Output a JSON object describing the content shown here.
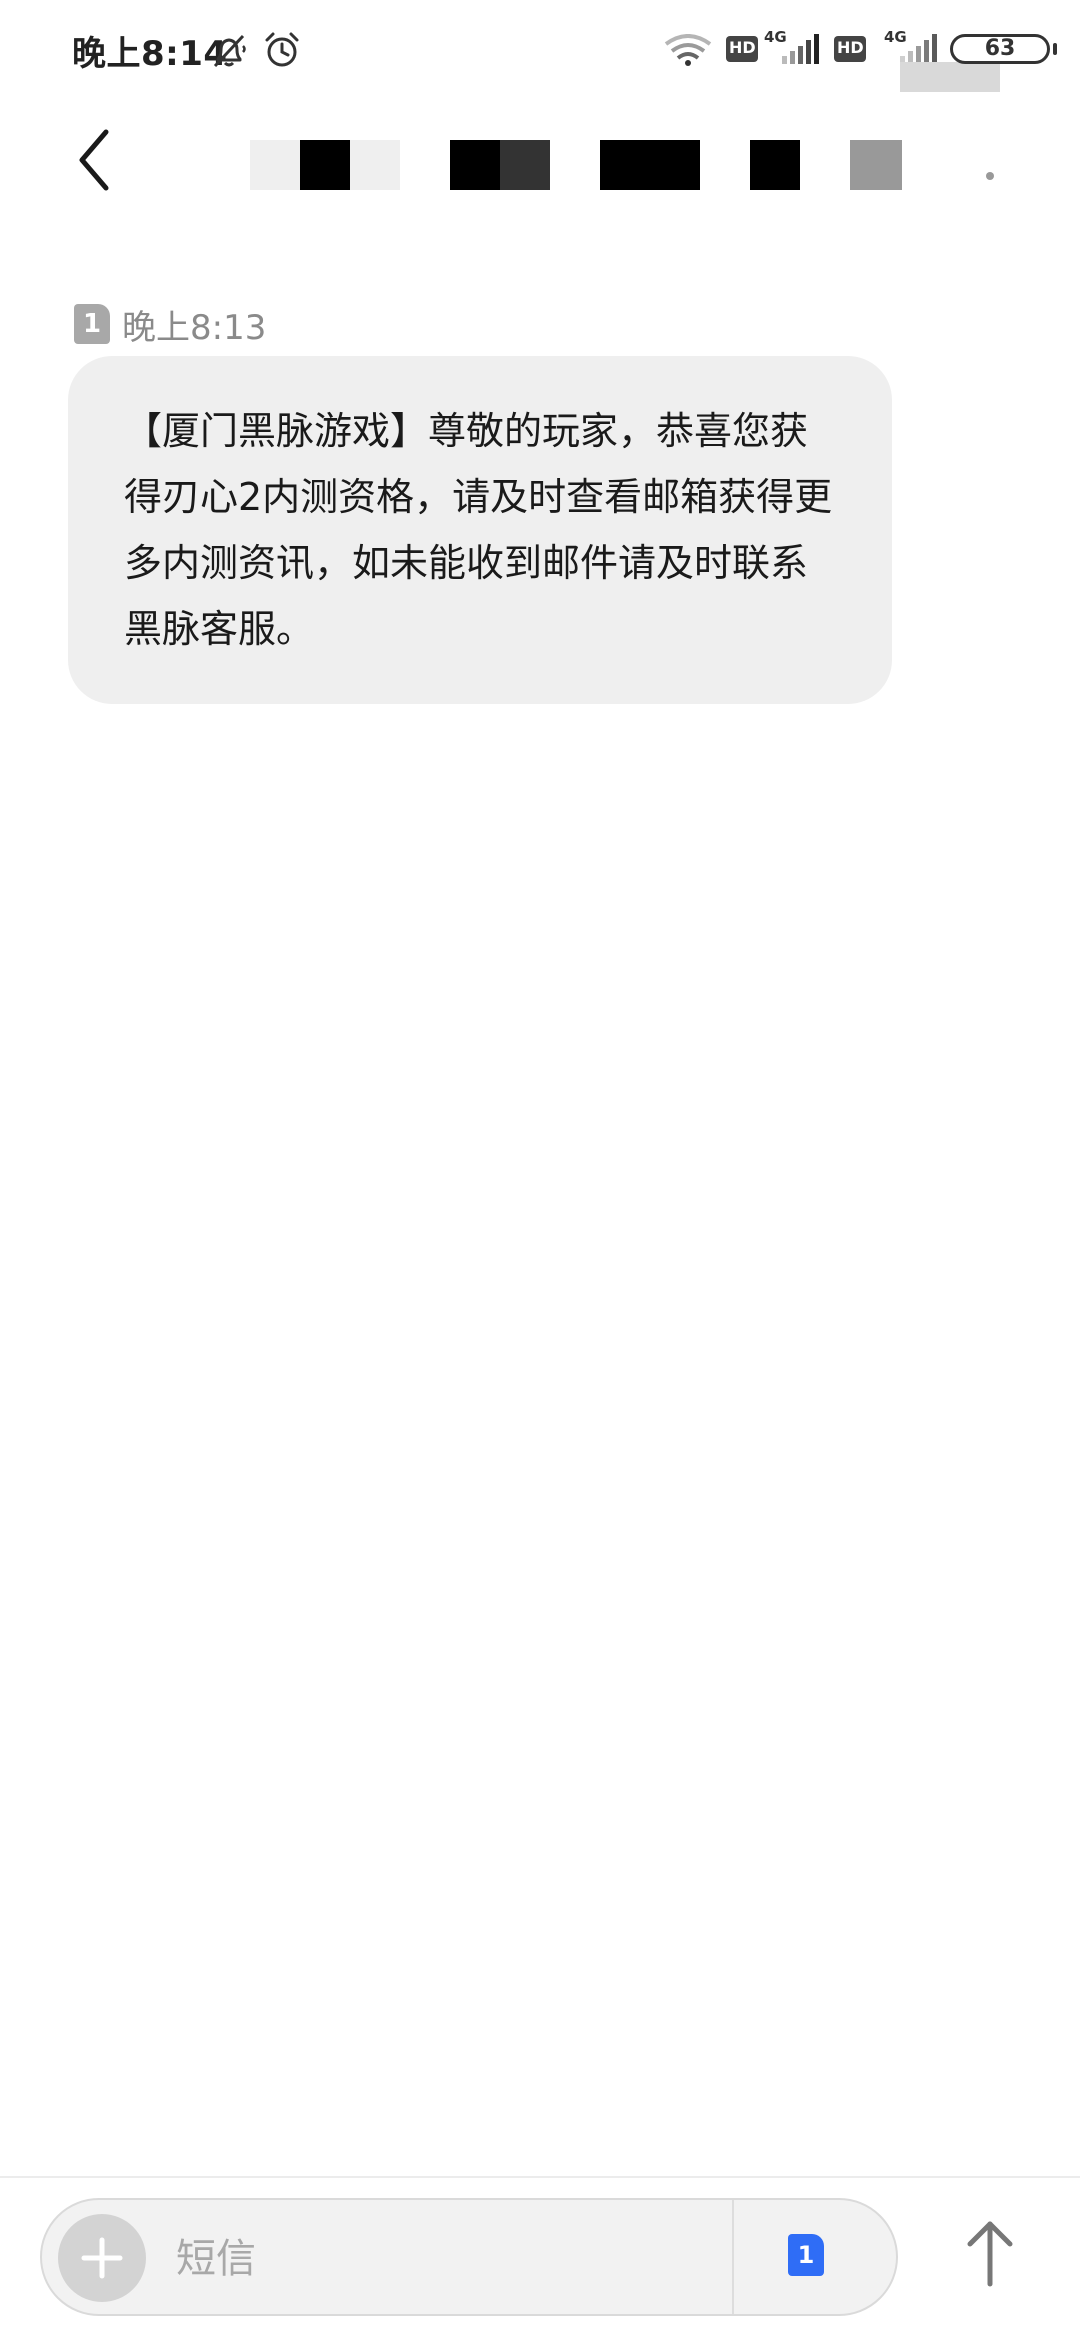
{
  "status_bar": {
    "time": "晚上8:14",
    "battery": "63",
    "network_1": "4G",
    "network_2": "4G",
    "hd_1": "HD",
    "hd_2": "HD",
    "icons": [
      "bell-muted-icon",
      "alarm-clock-icon",
      "wifi-icon",
      "hd-icon",
      "signal-icon",
      "battery-icon"
    ]
  },
  "header": {
    "back_icon": "chevron-left-icon",
    "contact_redacted": true
  },
  "thread": {
    "messages": [
      {
        "sim_slot": "1",
        "time": "晚上8:13",
        "text": "【厦门黑脉游戏】尊敬的玩家，恭喜您获得刃心2内测资格，请及时查看邮箱获得更多内测资讯，如未能收到邮件请及时联系黑脉客服。"
      }
    ]
  },
  "composer": {
    "add_icon": "plus-icon",
    "placeholder": "短信",
    "value": "",
    "sim_slot": "1",
    "send_icon": "arrow-up-icon"
  },
  "colors": {
    "bubble_bg": "#efefef",
    "sim_accent": "#2f6df6",
    "muted_text": "#8a8a8a"
  }
}
